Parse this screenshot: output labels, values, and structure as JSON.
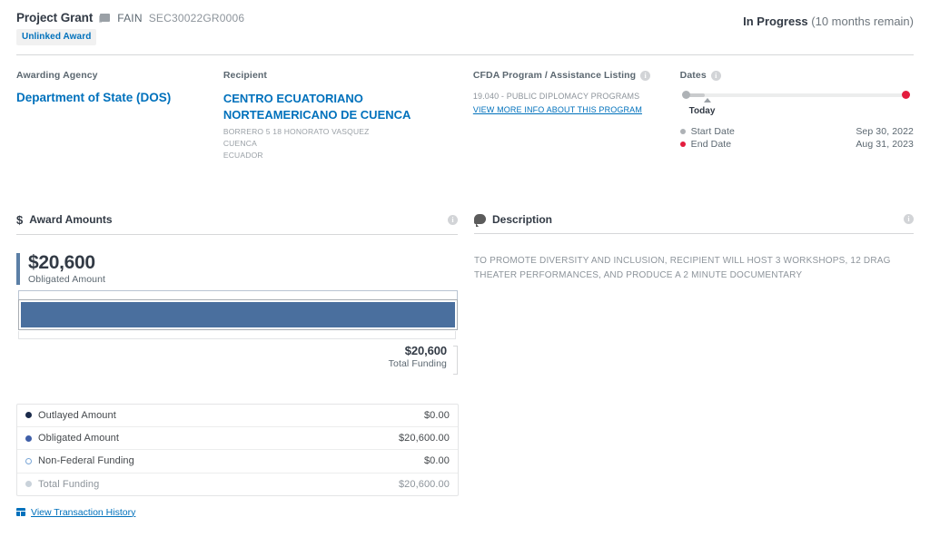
{
  "header": {
    "award_type": "Project Grant",
    "fain_icon": "document-icon",
    "fain_label": "FAIN",
    "fain_value": "SEC30022GR0006",
    "badge": "Unlinked Award",
    "status": "In Progress",
    "status_detail": "(10 months remain)"
  },
  "overview": {
    "agency": {
      "label": "Awarding Agency",
      "name": "Department of State (DOS)"
    },
    "recipient": {
      "label": "Recipient",
      "name": "CENTRO ECUATORIANO NORTEAMERICANO DE CUENCA",
      "address_line1": "BORRERO 5 18 HONORATO VASQUEZ",
      "address_line2": "CUENCA",
      "address_line3": "ECUADOR"
    },
    "cfda": {
      "label": "CFDA Program / Assistance Listing",
      "program": "19.040 - PUBLIC DIPLOMACY PROGRAMS",
      "link": "VIEW MORE INFO ABOUT THIS PROGRAM"
    },
    "dates": {
      "label": "Dates",
      "today_label": "Today",
      "rows": [
        {
          "name": "Start Date",
          "value": "Sep 30, 2022",
          "color": "#aeb2b6"
        },
        {
          "name": "End Date",
          "value": "Aug 31, 2023",
          "color": "#e31c3d"
        }
      ]
    }
  },
  "award_amounts": {
    "title": "Award Amounts",
    "dollar_glyph": "$",
    "obligated_amount": "$20,600",
    "obligated_caption": "Obligated Amount",
    "total_amount": "$20,600",
    "total_caption": "Total Funding",
    "rows": [
      {
        "name": "Outlayed Amount",
        "value": "$0.00",
        "marker": "filled",
        "color": "#1b2b4b"
      },
      {
        "name": "Obligated Amount",
        "value": "$20,600.00",
        "marker": "filled",
        "color": "#3f5fa8"
      },
      {
        "name": "Non-Federal Funding",
        "value": "$0.00",
        "marker": "hollow",
        "color": "#7ba7d7"
      },
      {
        "name": "Total Funding",
        "value": "$20,600.00",
        "marker": "filled",
        "color": "#c9d2da"
      }
    ],
    "transaction_link": "View Transaction History"
  },
  "description": {
    "title": "Description",
    "text": "TO PROMOTE DIVERSITY AND INCLUSION, RECIPIENT WILL HOST 3 WORKSHOPS, 12 DRAG THEATER PERFORMANCES, AND PRODUCE A 2 MINUTE DOCUMENTARY"
  },
  "icons": {
    "info": "i"
  }
}
